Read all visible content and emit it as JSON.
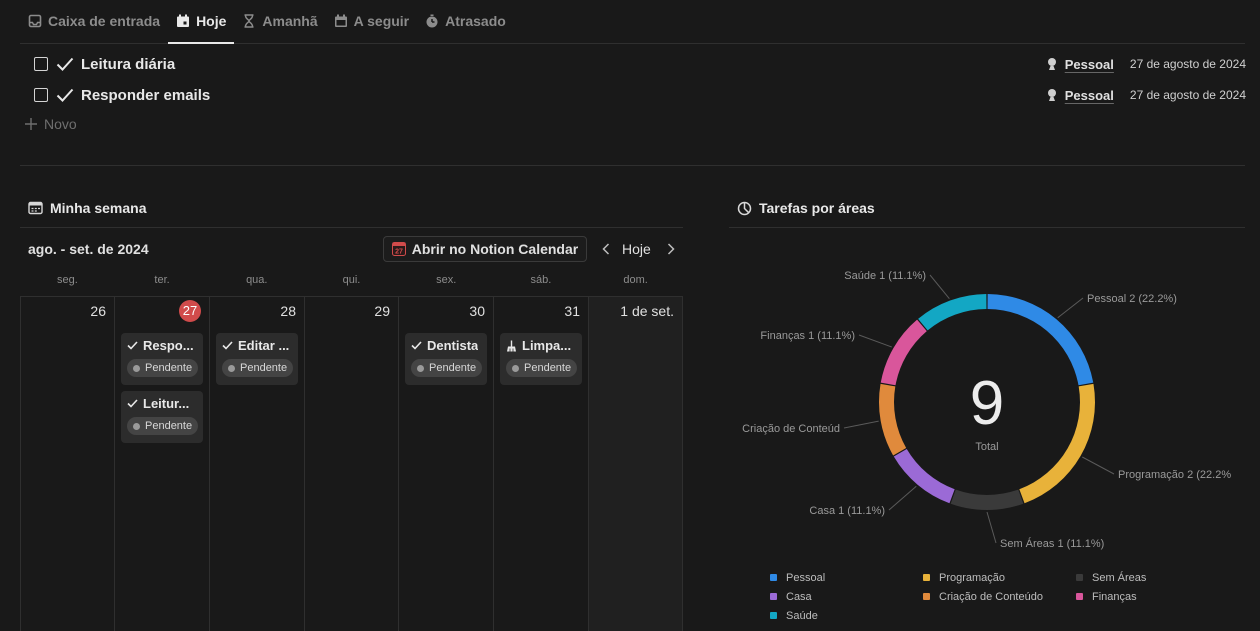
{
  "tabs": [
    {
      "label": "Caixa de entrada",
      "icon": "inbox-icon",
      "active": false
    },
    {
      "label": "Hoje",
      "icon": "calendar-today-icon",
      "active": true
    },
    {
      "label": "Amanhã",
      "icon": "hourglass-icon",
      "active": false
    },
    {
      "label": "A seguir",
      "icon": "calendar-icon",
      "active": false
    },
    {
      "label": "Atrasado",
      "icon": "alarm-icon",
      "active": false
    }
  ],
  "tasks": [
    {
      "title": "Leitura diária",
      "area": "Pessoal",
      "date": "27 de agosto de 2024"
    },
    {
      "title": "Responder emails",
      "area": "Pessoal",
      "date": "27 de agosto de 2024"
    }
  ],
  "new_label": "Novo",
  "week": {
    "title": "Minha semana",
    "range": "ago. - set. de 2024",
    "notion_button": "Abrir no Notion Calendar",
    "calendar_badge": "27",
    "today_button": "Hoje",
    "weekdays": [
      "seg.",
      "ter.",
      "qua.",
      "qui.",
      "sex.",
      "sáb.",
      "dom."
    ],
    "days": [
      {
        "num": "26",
        "today": false,
        "weekend": false,
        "events": []
      },
      {
        "num": "27",
        "today": true,
        "weekend": false,
        "events": [
          {
            "title": "Respo...",
            "status": "Pendente",
            "icon": "check-icon"
          },
          {
            "title": "Leitur...",
            "status": "Pendente",
            "icon": "check-icon"
          }
        ]
      },
      {
        "num": "28",
        "today": false,
        "weekend": false,
        "events": [
          {
            "title": "Editar ...",
            "status": "Pendente",
            "icon": "check-icon"
          }
        ]
      },
      {
        "num": "29",
        "today": false,
        "weekend": false,
        "events": []
      },
      {
        "num": "30",
        "today": false,
        "weekend": false,
        "events": [
          {
            "title": "Dentista",
            "status": "Pendente",
            "icon": "check-icon"
          }
        ]
      },
      {
        "num": "31",
        "today": false,
        "weekend": false,
        "events": [
          {
            "title": "Limpa...",
            "status": "Pendente",
            "icon": "broom-icon"
          }
        ]
      },
      {
        "num": "1 de set.",
        "today": false,
        "weekend": true,
        "events": []
      }
    ]
  },
  "chart_section": {
    "title": "Tarefas por áreas"
  },
  "chart_data": {
    "type": "pie",
    "title": "Tarefas por áreas",
    "total": "9",
    "total_label": "Total",
    "slices": [
      {
        "name": "Pessoal",
        "value": 2,
        "label": "Pessoal  2 (22.2%)",
        "color": "#2f8ae6"
      },
      {
        "name": "Programação",
        "value": 2,
        "label": "Programação  2 (22.2%",
        "color": "#e8b23a"
      },
      {
        "name": "Sem Áreas",
        "value": 1,
        "label": "Sem Áreas  1 (11.1%)",
        "color": "#3a3a3a"
      },
      {
        "name": "Casa",
        "value": 1,
        "label": "Casa  1 (11.1%)",
        "color": "#9b6ad6"
      },
      {
        "name": "Criação de Conteúdo",
        "value": 1,
        "label": "Criação de Conteúd",
        "color": "#e08a3c"
      },
      {
        "name": "Finanças",
        "value": 1,
        "label": "Finanças  1 (11.1%)",
        "color": "#d9569b"
      },
      {
        "name": "Saúde",
        "value": 1,
        "label": "Saúde  1 (11.1%)",
        "color": "#13a7c4"
      }
    ],
    "legend": [
      "Pessoal",
      "Programação",
      "Sem Áreas",
      "Casa",
      "Criação de Conteúdo",
      "Finanças",
      "Saúde"
    ]
  }
}
